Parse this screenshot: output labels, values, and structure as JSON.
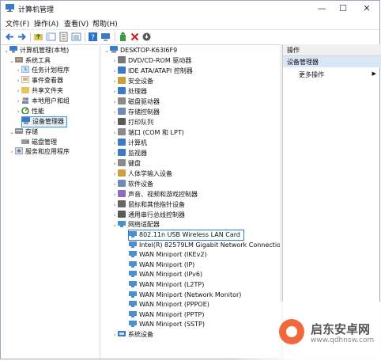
{
  "window": {
    "title": "计算机管理",
    "min": "—",
    "max": "☐",
    "close": "✕"
  },
  "menu": {
    "file": "文件(F)",
    "action": "操作(A)",
    "view": "查看(V)",
    "help": "帮助(H)"
  },
  "left_tree": {
    "root": "计算机管理(本地)",
    "system_tools": "系统工具",
    "task_scheduler": "任务计划程序",
    "event_viewer": "事件查看器",
    "shared_folders": "共享文件夹",
    "local_users": "本地用户和组",
    "performance": "性能",
    "device_manager": "设备管理器",
    "storage": "存储",
    "disk_management": "磁盘管理",
    "services": "服务和应用程序"
  },
  "device_tree": {
    "root": "DESKTOP-K63I6F9",
    "categories": [
      "DVD/CD-ROM 驱动器",
      "IDE ATA/ATAPI 控制器",
      "安全设备",
      "处理器",
      "磁盘驱动器",
      "存储控制器",
      "打印队列",
      "端口 (COM 和 LPT)",
      "计算机",
      "监视器",
      "键盘",
      "人体学输入设备",
      "软件设备",
      "声音、视频和游戏控制器",
      "鼠标和其他指针设备",
      "通用串行总线控制器"
    ],
    "network_category": "网络适配器",
    "network_devices": [
      "802.11n USB Wireless LAN Card",
      "Intel(R) 82579LM Gigabit Network Connectio",
      "WAN Miniport (IKEv2)",
      "WAN Miniport (IP)",
      "WAN Miniport (IPv6)",
      "WAN Miniport (L2TP)",
      "WAN Miniport (Network Monitor)",
      "WAN Miniport (PPPOE)",
      "WAN Miniport (PPTP)",
      "WAN Miniport (SSTP)"
    ],
    "last_category": "系统设备"
  },
  "actions": {
    "header": "操作",
    "selected": "设备管理器",
    "more": "更多操作"
  },
  "watermark": {
    "name": "启东安卓网",
    "url": "www.qdhnsw.com"
  }
}
